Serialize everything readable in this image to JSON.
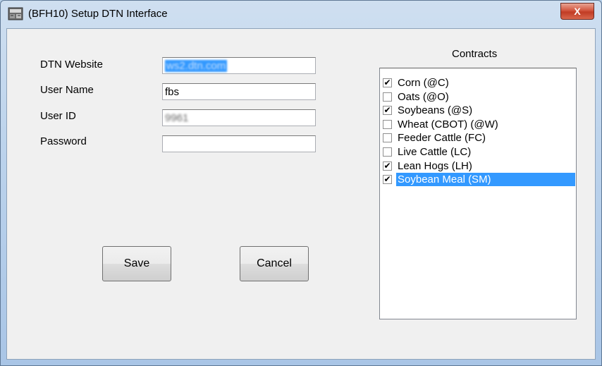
{
  "window": {
    "title": "(BFH10)  Setup DTN Interface",
    "close_glyph": "X",
    "app_icon": "application-icon"
  },
  "form": {
    "website_label": "DTN Website",
    "website_value": "ws2.dtn.com",
    "username_label": "User Name",
    "username_value": "fbs",
    "userid_label": "User ID",
    "userid_value": "9961",
    "password_label": "Password",
    "password_value": ""
  },
  "buttons": {
    "save": "Save",
    "cancel": "Cancel"
  },
  "contracts": {
    "title": "Contracts",
    "items": [
      {
        "label": "Corn  (@C)",
        "checked": true,
        "selected": false
      },
      {
        "label": "Oats  (@O)",
        "checked": false,
        "selected": false
      },
      {
        "label": "Soybeans  (@S)",
        "checked": true,
        "selected": false
      },
      {
        "label": "Wheat (CBOT)  (@W)",
        "checked": false,
        "selected": false
      },
      {
        "label": "Feeder Cattle  (FC)",
        "checked": false,
        "selected": false
      },
      {
        "label": "Live Cattle  (LC)",
        "checked": false,
        "selected": false
      },
      {
        "label": "Lean Hogs  (LH)",
        "checked": true,
        "selected": false
      },
      {
        "label": "Soybean Meal  (SM)",
        "checked": true,
        "selected": true
      }
    ]
  },
  "colors": {
    "selection": "#3399ff",
    "dialog_bg": "#f0f0f0",
    "close_button": "#c13c25"
  }
}
